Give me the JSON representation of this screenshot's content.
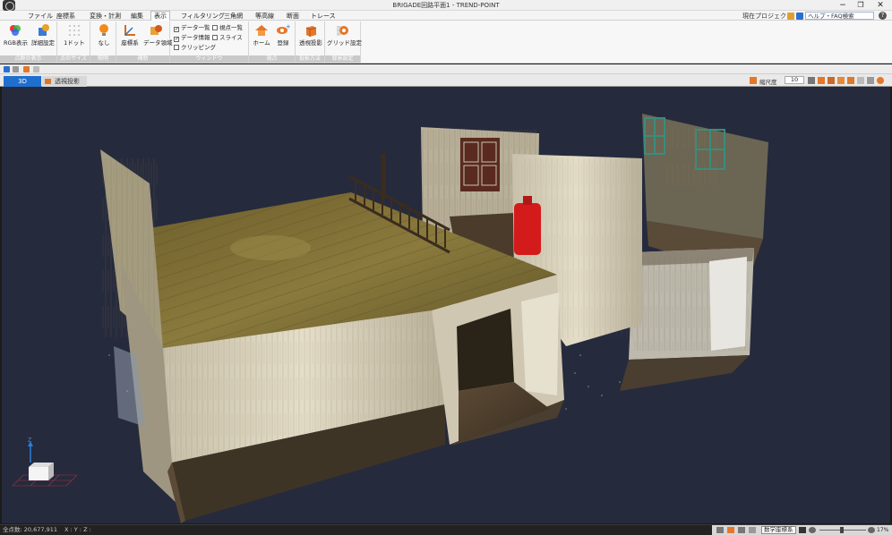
{
  "window": {
    "title": "BRIGADE回路平面1 - TREND-POINT",
    "minimize": "−",
    "restore": "❐",
    "close": "✕"
  },
  "menu": {
    "tabs": [
      "ファイル",
      "座標系",
      "変換・計測",
      "編集",
      "表示",
      "フィルタリング",
      "三角網",
      "等高線",
      "断面",
      "トレース"
    ],
    "active_index": 4,
    "project_label": "現在プロジェクト",
    "help_search": "ヘルプ・FAQ検索",
    "help_icon": "?"
  },
  "ribbon": {
    "groups": [
      {
        "label": "点群の表示",
        "buttons": [
          "RGB表示",
          "詳細設定"
        ]
      },
      {
        "label": "点のサイズ",
        "buttons": [
          "1ドット"
        ]
      },
      {
        "label": "照明",
        "buttons": [
          "なし"
        ]
      },
      {
        "label": "補助",
        "buttons": [
          "座標系",
          "データ領域"
        ]
      },
      {
        "label": "ウィンドウ",
        "checks": [
          "データ一覧",
          "データ情報",
          "クリッピング",
          "視点一覧",
          "スライス"
        ]
      },
      {
        "label": "視点",
        "buttons": [
          "ホーム",
          "登録"
        ]
      },
      {
        "label": "投影方法",
        "buttons": [
          "透視投影"
        ]
      },
      {
        "label": "背景設定",
        "buttons": [
          "グリッド設定"
        ]
      }
    ]
  },
  "doc_tabs": {
    "tabs": [
      "3D",
      "透視投影"
    ],
    "view_label": "縮尺度",
    "scale_value": "10"
  },
  "viewport": {
    "axis_label_z": "Z",
    "background": "#262a3d"
  },
  "status": {
    "point_count": "全点数: 20,677,911",
    "coords": "X :   Y :   Z :",
    "coord_mode": "数学座標系",
    "zoom_pct": "17%"
  },
  "colors": {
    "accent": "#1f6fcf",
    "fire_extinguisher": "#d41b1b"
  }
}
